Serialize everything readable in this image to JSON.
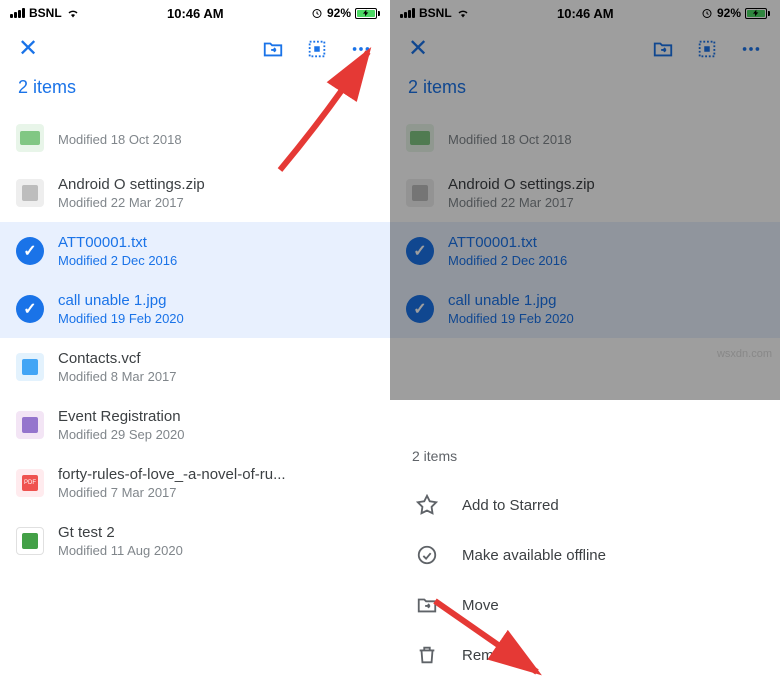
{
  "status_bar": {
    "carrier": "BSNL",
    "time": "10:46 AM",
    "battery_pct": "92%"
  },
  "toolbar": {
    "close": "✕",
    "title": "2 items"
  },
  "files": [
    {
      "name": "",
      "meta": "Modified 18 Oct 2018",
      "type": "folder",
      "selected": false
    },
    {
      "name": "Android O settings.zip",
      "meta": "Modified 22 Mar 2017",
      "type": "zip",
      "selected": false
    },
    {
      "name": "ATT00001.txt",
      "meta": "Modified 2 Dec 2016",
      "type": "txt",
      "selected": true
    },
    {
      "name": "call unable 1.jpg",
      "meta": "Modified 19 Feb 2020",
      "type": "jpg",
      "selected": true
    },
    {
      "name": "Contacts.vcf",
      "meta": "Modified 8 Mar 2017",
      "type": "vcf",
      "selected": false
    },
    {
      "name": "Event Registration",
      "meta": "Modified 29 Sep 2020",
      "type": "form",
      "selected": false
    },
    {
      "name": "forty-rules-of-love_-a-novel-of-ru...",
      "meta": "Modified 7 Mar 2017",
      "type": "pdf",
      "selected": false
    },
    {
      "name": "Gt test 2",
      "meta": "Modified 11 Aug 2020",
      "type": "sheet",
      "selected": false
    }
  ],
  "sheet": {
    "title": "2 items",
    "items": [
      {
        "label": "Add to Starred",
        "icon": "star"
      },
      {
        "label": "Make available offline",
        "icon": "offline"
      },
      {
        "label": "Move",
        "icon": "move"
      },
      {
        "label": "Remove",
        "icon": "trash"
      }
    ]
  },
  "watermark": "wsxdn.com"
}
